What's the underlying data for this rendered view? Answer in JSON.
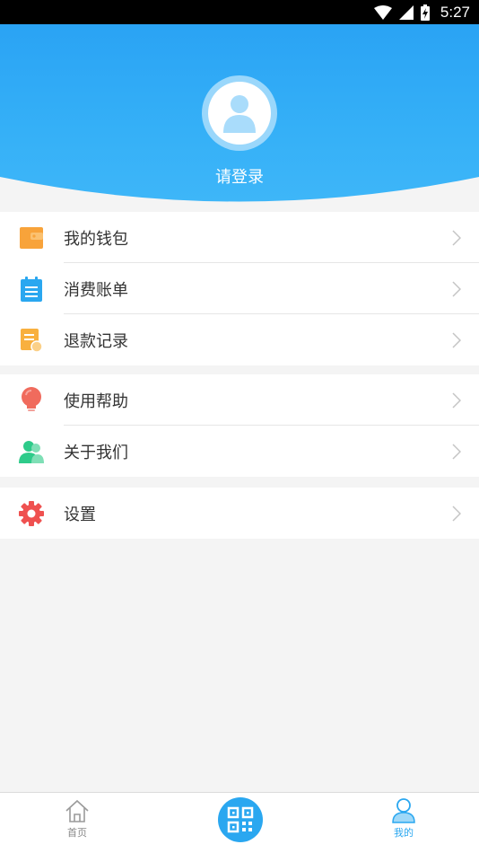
{
  "status_bar": {
    "time": "5:27"
  },
  "profile": {
    "login_prompt": "请登录"
  },
  "menu": {
    "group1": [
      {
        "label": "我的钱包",
        "icon": "wallet-icon"
      },
      {
        "label": "消费账单",
        "icon": "notepad-icon"
      },
      {
        "label": "退款记录",
        "icon": "refund-record-icon"
      }
    ],
    "group2": [
      {
        "label": "使用帮助",
        "icon": "lightbulb-icon"
      },
      {
        "label": "关于我们",
        "icon": "users-icon"
      }
    ],
    "group3": [
      {
        "label": "设置",
        "icon": "gear-icon"
      }
    ]
  },
  "bottom_nav": {
    "home": {
      "label": "首页",
      "icon": "home-icon"
    },
    "scan": {
      "icon": "qr-code-icon"
    },
    "mine": {
      "label": "我的",
      "icon": "user-icon",
      "active": true
    }
  },
  "colors": {
    "primary": "#2aa3f4",
    "active_tab": "#2aa7f0",
    "text": "#333333",
    "wallet": "#f8a33a",
    "notepad": "#2aa7f0",
    "refund": "#f8b03f",
    "help": "#f06b5d",
    "about": "#2ecb8a",
    "settings": "#ef5150"
  }
}
